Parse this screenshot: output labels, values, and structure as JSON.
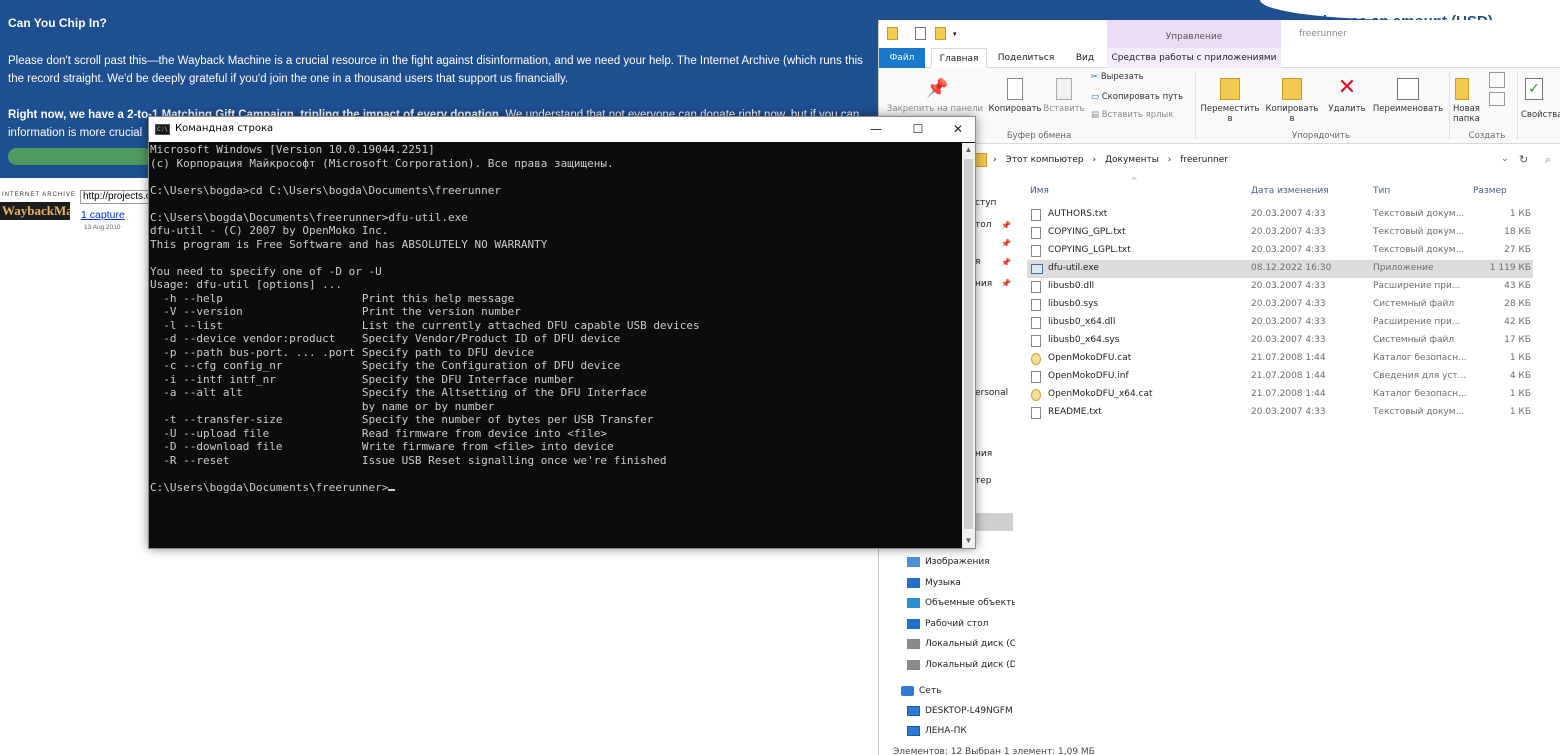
{
  "banner": {
    "title": "Can You Chip In?",
    "para1_line1": "Please don't scroll past this—the Wayback Machine is a crucial resource in the fight against disinformation, and we need your help. The Internet Archive (which runs this",
    "para1_line2": "the record straight. We'd be deeply grateful if you'd join the one in a thousand users that support us financially.",
    "para2_bold": "Right now, we have a 2-to-1 ",
    "para2_link": "Matching Gift Campaign",
    "para2_bold2": ", tripling the impact of every donation.",
    "para2_rest": " We understand that not everyone can donate right now, but if you can",
    "para2_line2": "information is more crucial",
    "choose_amount": "Choose an amount (USD)",
    "bg_color": "#1e4f91"
  },
  "wayback": {
    "ia_text": "INTERNET ARCHIVE",
    "logo": "WaybackMachine",
    "url_value": "http://projects.o",
    "captures": "1 capture",
    "capture_date": "13 Aug 2010"
  },
  "cmd": {
    "title": "Командная строка",
    "icon_text": "C:\\",
    "buttons": {
      "minimize": "—",
      "maximize": "☐",
      "close": "✕"
    },
    "lines": [
      "Microsoft Windows [Version 10.0.19044.2251]",
      "(c) Корпорация Майкрософт (Microsoft Corporation). Все права защищены.",
      "",
      "C:\\Users\\bogda>cd C:\\Users\\bogda\\Documents\\freerunner",
      "",
      "C:\\Users\\bogda\\Documents\\freerunner>dfu-util.exe",
      "dfu-util - (C) 2007 by OpenMoko Inc.",
      "This program is Free Software and has ABSOLUTELY NO WARRANTY",
      "",
      "You need to specify one of -D or -U",
      "Usage: dfu-util [options] ...",
      "  -h --help                     Print this help message",
      "  -V --version                  Print the version number",
      "  -l --list                     List the currently attached DFU capable USB devices",
      "  -d --device vendor:product    Specify Vendor/Product ID of DFU device",
      "  -p --path bus-port. ... .port Specify path to DFU device",
      "  -c --cfg config_nr            Specify the Configuration of DFU device",
      "  -i --intf intf_nr             Specify the DFU Interface number",
      "  -a --alt alt                  Specify the Altsetting of the DFU Interface",
      "                                by name or by number",
      "  -t --transfer-size            Specify the number of bytes per USB Transfer",
      "  -U --upload file              Read firmware from device into <file>",
      "  -D --download file            Write firmware from <file> into device",
      "  -R --reset                    Issue USB Reset signalling once we're finished",
      ""
    ],
    "prompt": "C:\\Users\\bogda\\Documents\\freerunner>"
  },
  "explorer": {
    "manage_tab": "Управление",
    "window_title": "freerunner",
    "tabs": [
      "Файл",
      "Главная",
      "Поделиться",
      "Вид",
      "Средства работы с приложениями"
    ],
    "ribbon": {
      "pin": "Закрепить на панели",
      "copy": "Копировать",
      "paste": "Вставить",
      "cut": "Вырезать",
      "copy_path": "Скопировать путь",
      "paste_shortcut": "Вставить ярлык",
      "move_to_1": "Переместить",
      "move_to_2": "в",
      "copy_to_1": "Копировать",
      "copy_to_2": "в",
      "delete": "Удалить",
      "rename": "Переименовать",
      "new_folder_1": "Новая",
      "new_folder_2": "папка",
      "properties": "Свойства",
      "group_clipboard": "Буфер обмена",
      "group_organize": "Упорядочить",
      "group_create": "Создать"
    },
    "path": [
      "Этот компьютер",
      "Документы",
      "freerunner"
    ],
    "columns": {
      "name": "Имя",
      "date": "Дата изменения",
      "type": "Тип",
      "size": "Размер"
    },
    "files": [
      {
        "name": "AUTHORS.txt",
        "date": "20.03.2007 4:33",
        "type": "Текстовый докум...",
        "size": "1 КБ"
      },
      {
        "name": "COPYING_GPL.txt",
        "date": "20.03.2007 4:33",
        "type": "Текстовый докум...",
        "size": "18 КБ"
      },
      {
        "name": "COPYING_LGPL.txt",
        "date": "20.03.2007 4:33",
        "type": "Текстовый докум...",
        "size": "27 КБ"
      },
      {
        "name": "dfu-util.exe",
        "date": "08.12.2022 16:30",
        "type": "Приложение",
        "size": "1 119 КБ"
      },
      {
        "name": "libusb0.dll",
        "date": "20.03.2007 4:33",
        "type": "Расширение при...",
        "size": "43 КБ"
      },
      {
        "name": "libusb0.sys",
        "date": "20.03.2007 4:33",
        "type": "Системный файл",
        "size": "28 КБ"
      },
      {
        "name": "libusb0_x64.dll",
        "date": "20.03.2007 4:33",
        "type": "Расширение при...",
        "size": "42 КБ"
      },
      {
        "name": "libusb0_x64.sys",
        "date": "20.03.2007 4:33",
        "type": "Системный файл",
        "size": "17 КБ"
      },
      {
        "name": "OpenMokoDFU.cat",
        "date": "21.07.2008 1:44",
        "type": "Каталог безопасн...",
        "size": "1 КБ"
      },
      {
        "name": "OpenMokoDFU.inf",
        "date": "21.07.2008 1:44",
        "type": "Сведения для уст...",
        "size": "4 КБ"
      },
      {
        "name": "OpenMokoDFU_x64.cat",
        "date": "21.07.2008 1:44",
        "type": "Каталог безопасн...",
        "size": "1 КБ"
      },
      {
        "name": "README.txt",
        "date": "20.03.2007 4:33",
        "type": "Текстовый докум...",
        "size": "1 КБ"
      }
    ],
    "nav_partial": [
      "ступ",
      "тол",
      "я",
      "ния",
      "ersonal",
      "ния",
      "тер"
    ],
    "nav": [
      {
        "label": "Изображения",
        "icon": "pictures-icon"
      },
      {
        "label": "Музыка",
        "icon": "music-icon"
      },
      {
        "label": "Объемные объекты",
        "icon": "3d-objects-icon"
      },
      {
        "label": "Рабочий стол",
        "icon": "desktop-icon"
      },
      {
        "label": "Локальный диск (C",
        "icon": "drive-icon"
      },
      {
        "label": "Локальный диск (D",
        "icon": "drive-icon"
      }
    ],
    "network": "Сеть",
    "network_items": [
      "DESKTOP-L49NGFM",
      "ЛЕНА-ПК"
    ],
    "status": "Элементов: 12     Выбран 1 элемент: 1,09 МБ"
  }
}
